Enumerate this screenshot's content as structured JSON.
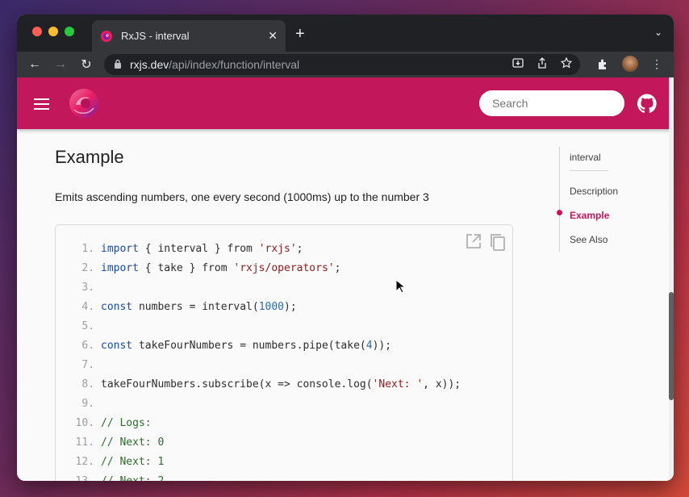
{
  "browser": {
    "tab_title": "RxJS - interval",
    "tab_close": "✕",
    "new_tab": "+",
    "tab_menu": "⌄",
    "url_host": "rxjs.dev",
    "url_path": "/api/index/function/interval"
  },
  "header": {
    "search_placeholder": "Search"
  },
  "content": {
    "heading": "Example",
    "description": "Emits ascending numbers, one every second (1000ms) up to the number 3"
  },
  "code": {
    "lines": [
      {
        "n": "1.",
        "parts": [
          [
            "kw",
            "import"
          ],
          [
            "txt",
            " { interval } from "
          ],
          [
            "str",
            "'rxjs'"
          ],
          [
            "txt",
            ";"
          ]
        ]
      },
      {
        "n": "2.",
        "parts": [
          [
            "kw",
            "import"
          ],
          [
            "txt",
            " { take } from "
          ],
          [
            "str",
            "'rxjs/operators'"
          ],
          [
            "txt",
            ";"
          ]
        ]
      },
      {
        "n": "3.",
        "parts": []
      },
      {
        "n": "4.",
        "parts": [
          [
            "kw",
            "const"
          ],
          [
            "txt",
            " numbers = interval("
          ],
          [
            "num",
            "1000"
          ],
          [
            "txt",
            ");"
          ]
        ]
      },
      {
        "n": "5.",
        "parts": []
      },
      {
        "n": "6.",
        "parts": [
          [
            "kw",
            "const"
          ],
          [
            "txt",
            " takeFourNumbers = numbers.pipe(take("
          ],
          [
            "num",
            "4"
          ],
          [
            "txt",
            "));"
          ]
        ]
      },
      {
        "n": "7.",
        "parts": []
      },
      {
        "n": "8.",
        "parts": [
          [
            "txt",
            "takeFourNumbers.subscribe(x => console.log("
          ],
          [
            "str",
            "'Next: '"
          ],
          [
            "txt",
            ", x));"
          ]
        ]
      },
      {
        "n": "9.",
        "parts": []
      },
      {
        "n": "10.",
        "parts": [
          [
            "cmt",
            "// Logs:"
          ]
        ]
      },
      {
        "n": "11.",
        "parts": [
          [
            "cmt",
            "// Next: 0"
          ]
        ]
      },
      {
        "n": "12.",
        "parts": [
          [
            "cmt",
            "// Next: 1"
          ]
        ]
      },
      {
        "n": "13.",
        "parts": [
          [
            "cmt",
            "// Next: 2"
          ]
        ]
      }
    ]
  },
  "toc": {
    "title": "interval",
    "items": [
      "Description",
      "Example",
      "See Also"
    ],
    "active": "Example"
  },
  "colors": {
    "brand": "#c2185b"
  }
}
